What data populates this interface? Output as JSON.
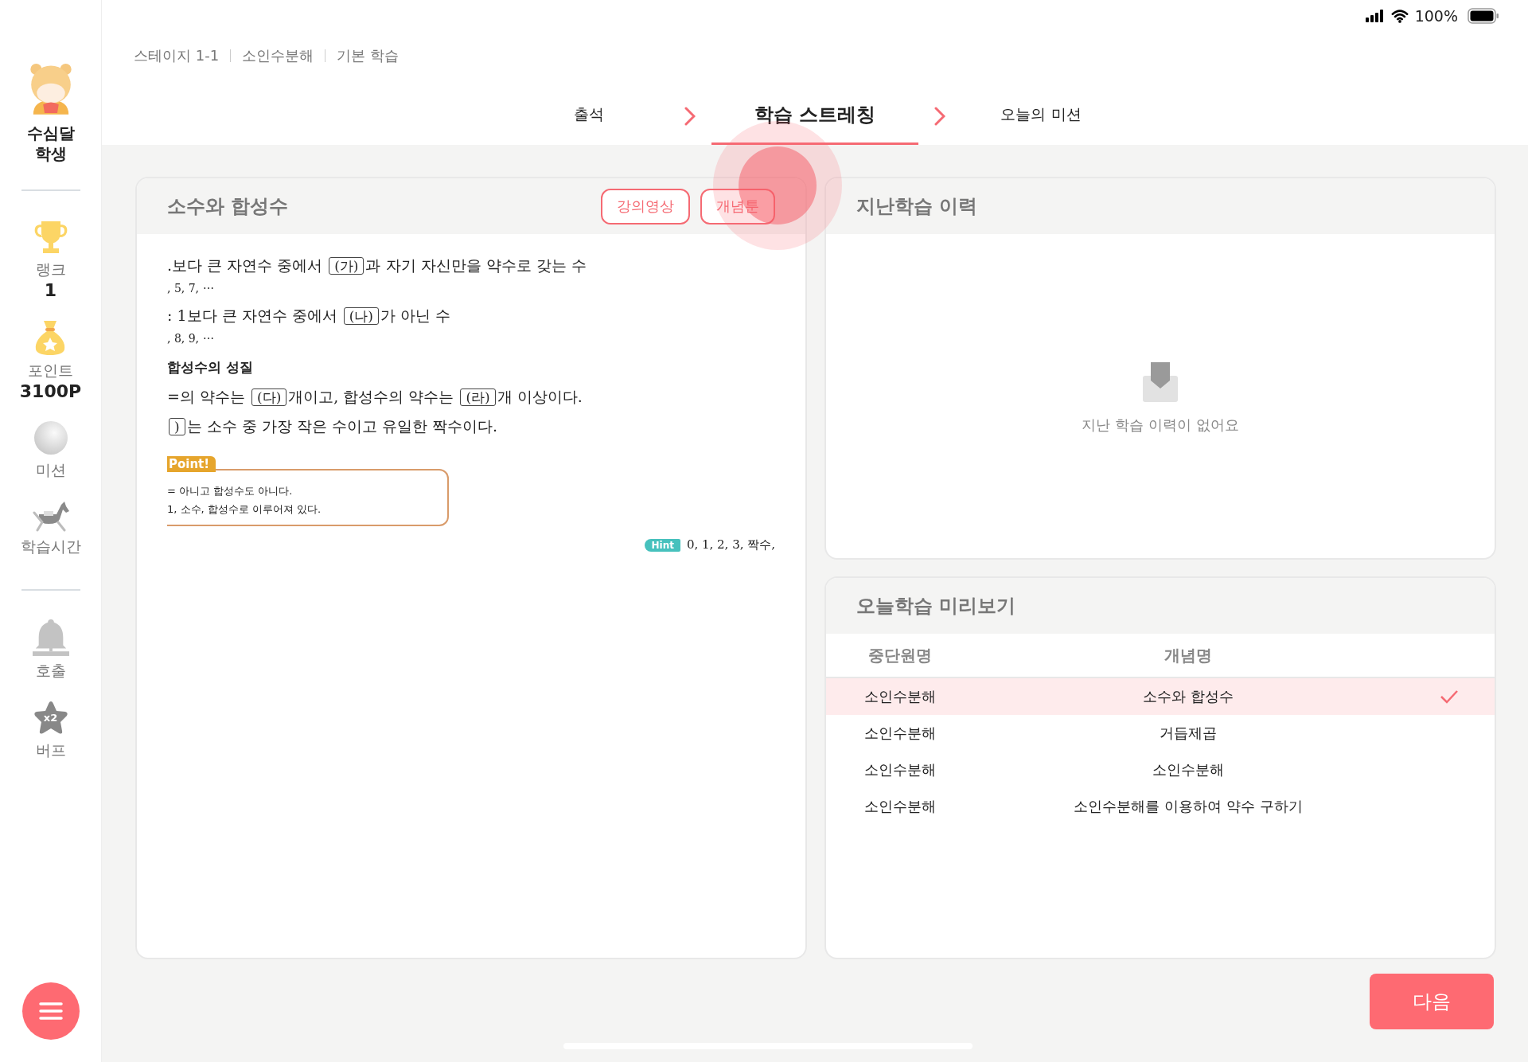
{
  "status_bar": {
    "battery": "100%"
  },
  "sidebar": {
    "user": "수심달 학생",
    "stats": [
      {
        "kind": "trophy",
        "label": "랭크",
        "value": "1"
      },
      {
        "kind": "bag",
        "label": "포인트",
        "value": "3100P"
      },
      {
        "kind": "sphere",
        "label": "미션"
      },
      {
        "kind": "horse",
        "label": "학습시간"
      }
    ],
    "actions": [
      {
        "kind": "bell",
        "label": "호출"
      },
      {
        "kind": "buff",
        "label": "버프",
        "badge": "x2"
      }
    ]
  },
  "breadcrumb": [
    "스테이지 1-1",
    "소인수분해",
    "기본 학습"
  ],
  "steps": [
    {
      "label": "출석",
      "selected": false
    },
    {
      "label": "학습 스트레칭",
      "selected": true
    },
    {
      "label": "오늘의 미션",
      "selected": false
    }
  ],
  "concept_card": {
    "title": "소수와 합성수",
    "buttons": [
      "강의영상",
      "개념툰"
    ],
    "lines": [
      {
        "kind": "main",
        "parts": [
          {
            "kind": "text",
            "text": ".보다 큰 자연수 중에서 "
          },
          {
            "kind": "box",
            "text": "(가)"
          },
          {
            "kind": "text",
            "text": "과 자기 자신만을 약수로 갖는 수"
          }
        ]
      },
      {
        "kind": "example",
        "parts": [
          {
            "kind": "text",
            "text": ", 5, 7, ⋯"
          }
        ]
      },
      {
        "kind": "main",
        "parts": [
          {
            "kind": "text",
            "text": ": 1보다 큰 자연수 중에서 "
          },
          {
            "kind": "box",
            "text": "(나)"
          },
          {
            "kind": "text",
            "text": "가 아닌 수"
          }
        ]
      },
      {
        "kind": "example",
        "parts": [
          {
            "kind": "text",
            "text": ", 8, 9, ⋯"
          }
        ]
      },
      {
        "kind": "heading",
        "parts": [
          {
            "kind": "text",
            "text": "합성수의 성질"
          }
        ]
      },
      {
        "kind": "main",
        "parts": [
          {
            "kind": "text",
            "text": "=의 약수는 "
          },
          {
            "kind": "box",
            "text": "(다)"
          },
          {
            "kind": "text",
            "text": "개이고, 합성수의 약수는 "
          },
          {
            "kind": "box",
            "text": "(라)"
          },
          {
            "kind": "text",
            "text": "개 이상이다."
          }
        ]
      },
      {
        "kind": "main",
        "parts": [
          {
            "kind": "box",
            "text": ")"
          },
          {
            "kind": "text",
            "text": "는 소수 중 가장 작은 수이고 유일한 짝수이다."
          }
        ]
      }
    ],
    "point": {
      "tag": "Point!",
      "lines": [
        "= 아니고 합성수도 아니다.",
        "1, 소수, 합성수로 이루어져 있다."
      ]
    },
    "hint": {
      "tag": "Hint",
      "text": "0, 1, 2, 3, 짝수,"
    }
  },
  "history_card": {
    "title": "지난학습 이력",
    "empty_message": "지난 학습 이력이 없어요"
  },
  "preview_card": {
    "title": "오늘학습 미리보기",
    "columns": [
      "중단원명",
      "개념명"
    ],
    "rows": [
      {
        "unit": "소인수분해",
        "concept": "소수와 합성수",
        "selected": true
      },
      {
        "unit": "소인수분해",
        "concept": "거듭제곱",
        "selected": false
      },
      {
        "unit": "소인수분해",
        "concept": "소인수분해",
        "selected": false
      },
      {
        "unit": "소인수분해",
        "concept": "소인수분해를 이용하여 약수 구하기",
        "selected": false
      }
    ]
  },
  "next_button": "다음"
}
